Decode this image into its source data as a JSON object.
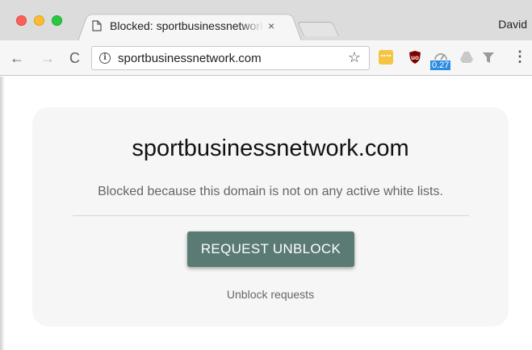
{
  "browser": {
    "tab": {
      "title": "Blocked: sportbusinessnetwork.com",
      "close_glyph": "×"
    },
    "profile_name": "David",
    "address_bar": {
      "url": "sportbusinessnetwork.com"
    },
    "extensions": [
      {
        "name": "notes-extension-icon"
      },
      {
        "name": "ublock-icon"
      },
      {
        "name": "meter-extension-icon",
        "badge": "0.27"
      },
      {
        "name": "drive-icon"
      },
      {
        "name": "filter-icon"
      }
    ],
    "nav": {
      "back": "←",
      "forward": "→",
      "reload": "C",
      "star": "☆",
      "menu": "⋮"
    }
  },
  "page": {
    "domain": "sportbusinessnetwork.com",
    "message": "Blocked because this domain is not on any active white lists.",
    "button_label": "REQUEST UNBLOCK",
    "link_label": "Unblock requests"
  },
  "colors": {
    "button": "#5a7a74",
    "card": "#f6f6f6"
  }
}
